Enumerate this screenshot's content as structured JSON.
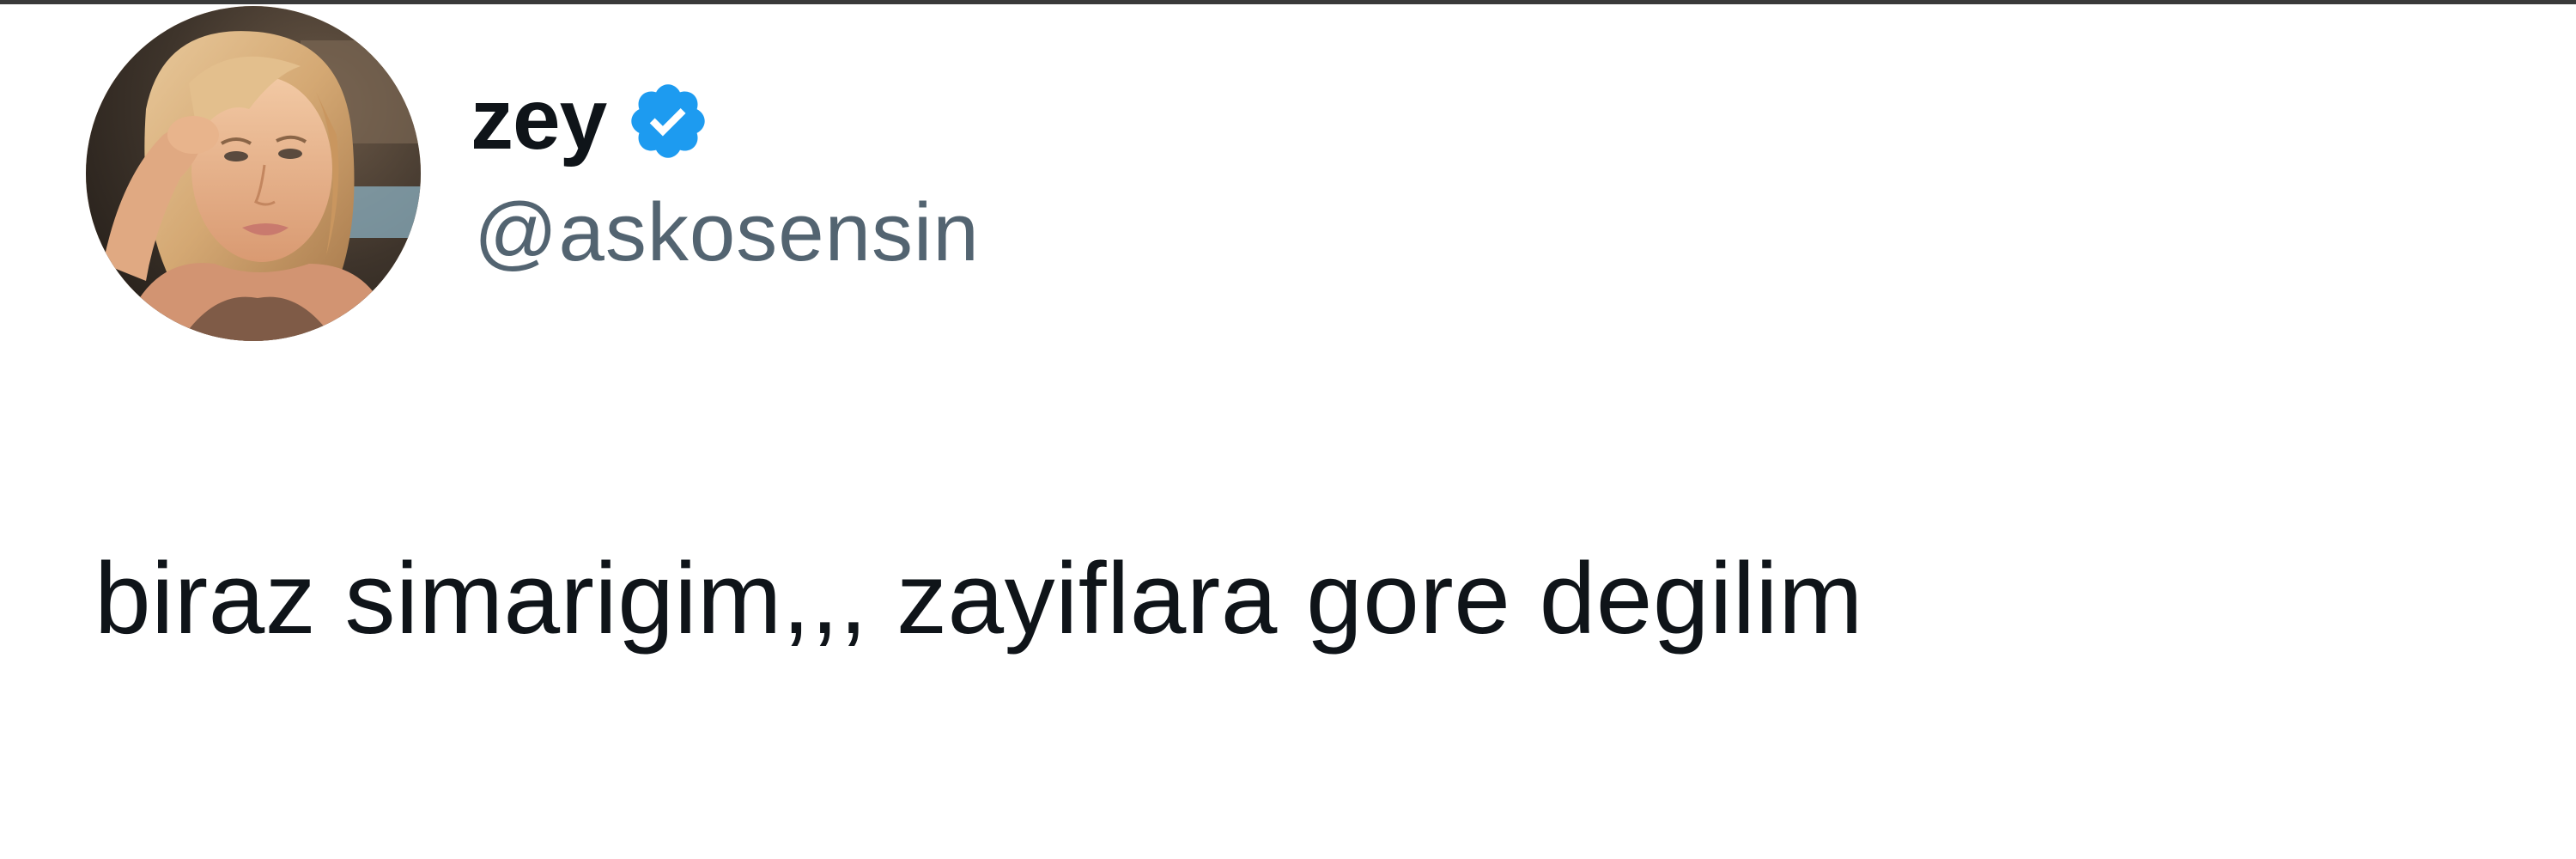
{
  "tweet": {
    "author": {
      "display_name": "zey",
      "verified": true,
      "handle": "@askosensin",
      "avatar_icon": "profile-photo"
    },
    "text": "biraz simarigim,,, zayiflara gore degilim"
  },
  "colors": {
    "name_text": "#0f1419",
    "handle_text": "#536471",
    "verified_badge": "#1d9bf0",
    "background": "#ffffff"
  }
}
